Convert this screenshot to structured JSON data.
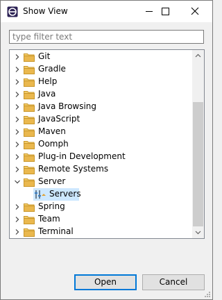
{
  "window": {
    "title": "Show View"
  },
  "filter": {
    "placeholder": "type filter text",
    "value": ""
  },
  "tree": {
    "items": [
      {
        "label": "Git",
        "expanded": false
      },
      {
        "label": "Gradle",
        "expanded": false
      },
      {
        "label": "Help",
        "expanded": false
      },
      {
        "label": "Java",
        "expanded": false
      },
      {
        "label": "Java Browsing",
        "expanded": false
      },
      {
        "label": "JavaScript",
        "expanded": false
      },
      {
        "label": "Maven",
        "expanded": false
      },
      {
        "label": "Oomph",
        "expanded": false
      },
      {
        "label": "Plug-in Development",
        "expanded": false
      },
      {
        "label": "Remote Systems",
        "expanded": false
      },
      {
        "label": "Server",
        "expanded": true
      },
      {
        "label": "Servers",
        "child": true,
        "selected": true
      },
      {
        "label": "Spring",
        "expanded": false
      },
      {
        "label": "Team",
        "expanded": false
      },
      {
        "label": "Terminal",
        "expanded": false
      }
    ]
  },
  "buttons": {
    "open": "Open",
    "cancel": "Cancel"
  },
  "colors": {
    "selection": "#cde8ff",
    "folder": "#e8b64c",
    "default_button_border": "#0078d7"
  }
}
